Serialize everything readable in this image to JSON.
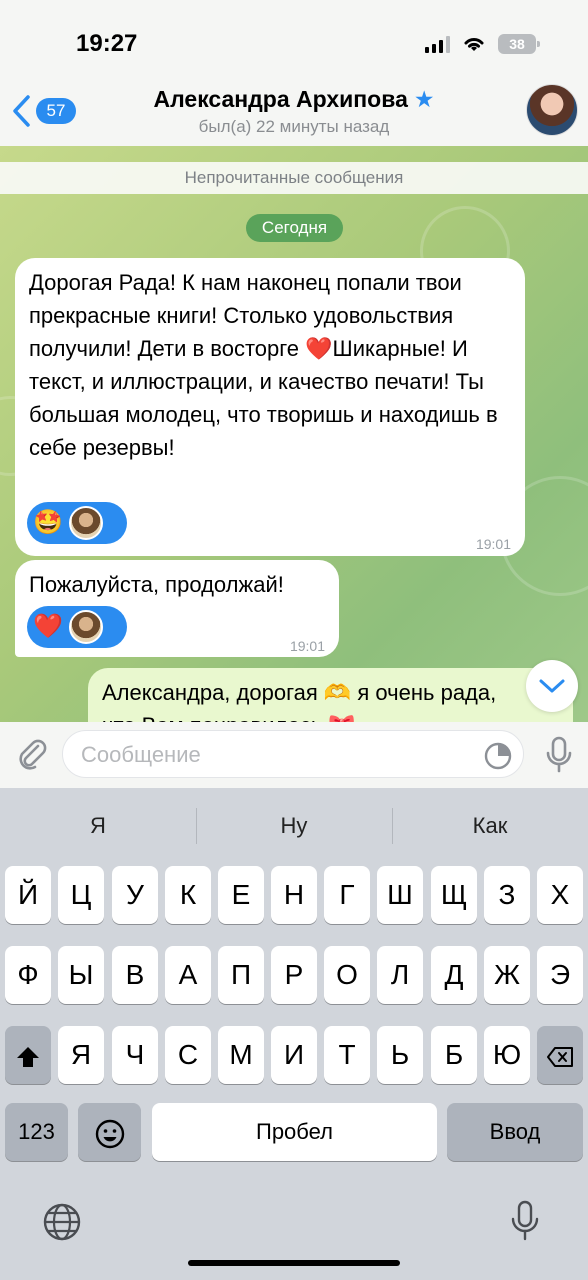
{
  "status": {
    "time": "19:27",
    "battery": "38"
  },
  "header": {
    "back_count": "57",
    "name": "Александра Архипова",
    "star": "★",
    "last_seen": "был(а) 22 минуты назад"
  },
  "chat": {
    "unread_label": "Непрочитанные сообщения",
    "date_chip": "Сегодня",
    "messages": [
      {
        "text": "Дорогая Рада! К нам наконец попали твои прекрасные книги! Столько удовольствия получили! Дети в восторге ❤️Шикарные! И текст, и иллюстрации, и качество печати! Ты большая молодец, что творишь и находишь в себе резервы!",
        "reaction": "🤩",
        "time": "19:01"
      },
      {
        "text": "Пожалуйста, продолжай!",
        "reaction": "❤️",
        "time": "19:01"
      },
      {
        "text": "Александра, дорогая 🫶 я очень рада, что Вам понравилось 🎀"
      }
    ]
  },
  "input": {
    "placeholder": "Сообщение"
  },
  "keyboard": {
    "suggestions": [
      "Я",
      "Ну",
      "Как"
    ],
    "row1": [
      "Й",
      "Ц",
      "У",
      "К",
      "Е",
      "Н",
      "Г",
      "Ш",
      "Щ",
      "З",
      "Х"
    ],
    "row2": [
      "Ф",
      "Ы",
      "В",
      "А",
      "П",
      "Р",
      "О",
      "Л",
      "Д",
      "Ж",
      "Э"
    ],
    "row3": [
      "Я",
      "Ч",
      "С",
      "М",
      "И",
      "Т",
      "Ь",
      "Б",
      "Ю"
    ],
    "numbers_label": "123",
    "space_label": "Пробел",
    "enter_label": "Ввод"
  }
}
